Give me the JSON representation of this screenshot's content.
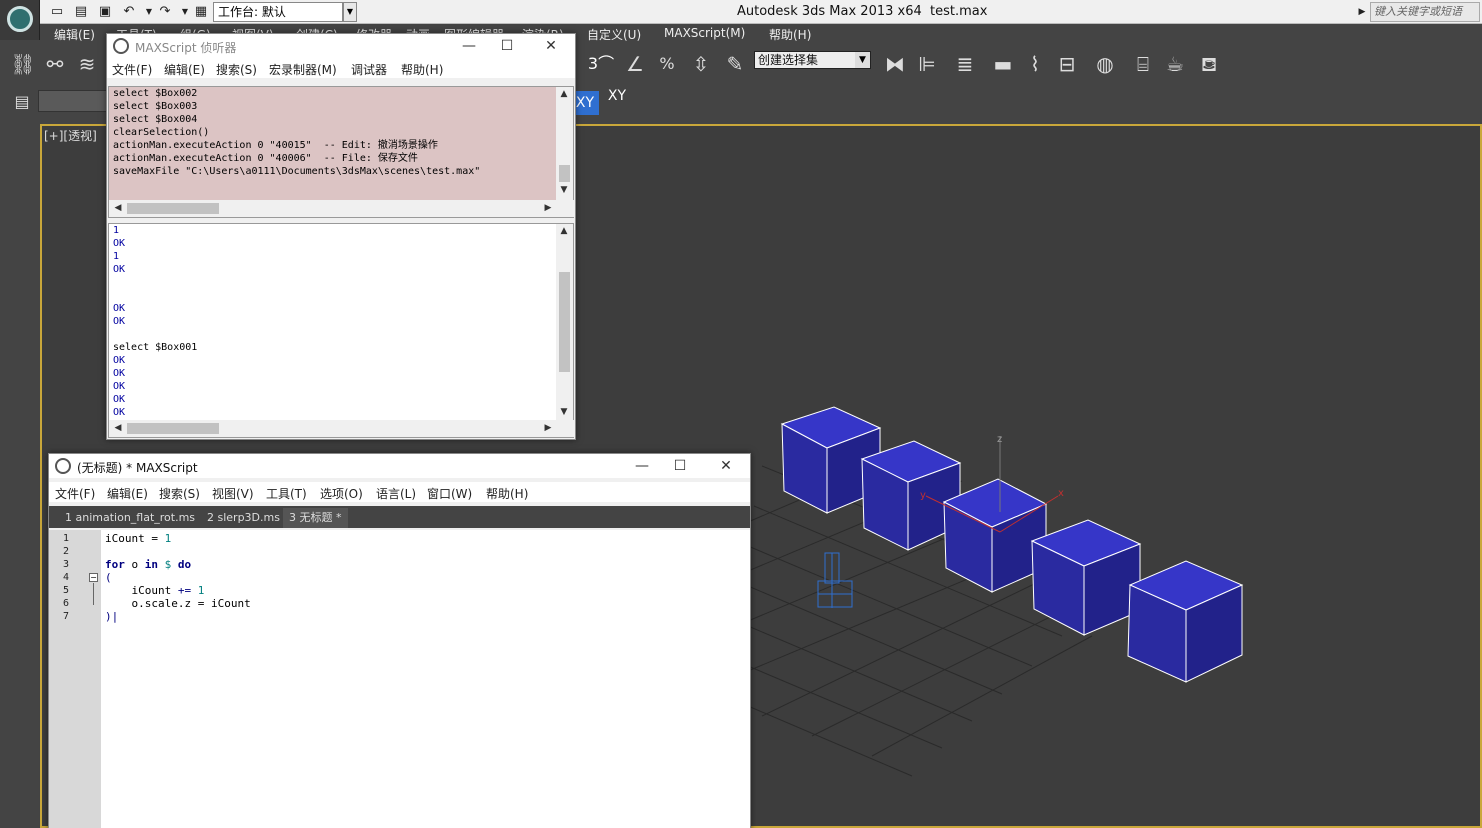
{
  "app": {
    "title": "Autodesk 3ds Max  2013 x64",
    "file": "test.max",
    "workspace_label": "工作台: 默认",
    "help_search_placeholder": "键入关键字或短语"
  },
  "menubar": {
    "items": [
      "编辑(E)",
      "工具(T)",
      "组(G)",
      "视图(V)",
      "创建(C)",
      "修改器",
      "动画",
      "图形编辑器",
      "渲染(R)",
      "自定义(U)",
      "MAXScript(M)",
      "帮助(H)"
    ]
  },
  "toolbar": {
    "selection_set_placeholder": "创建选择集",
    "axis_constraint": "XY",
    "axis_constraint_snap": "XY"
  },
  "viewport": {
    "label": "[+][透视]",
    "box_color": "#2b2ba8",
    "grid_color": "#2a2a2a",
    "axis_labels": {
      "z": "z",
      "x": "x",
      "y": "y"
    }
  },
  "listener": {
    "title": "MAXScript 侦听器",
    "menu": [
      "文件(F)",
      "编辑(E)",
      "搜索(S)",
      "宏录制器(M)",
      "调试器",
      "帮助(H)"
    ],
    "macro_pane_bg": "#dcc4c4",
    "macro_lines": [
      "select $Box002",
      "select $Box003",
      "select $Box004",
      "clearSelection()",
      "actionMan.executeAction 0 \"40015\"  -- Edit: 撤消场景操作",
      "actionMan.executeAction 0 \"40006\"  -- File: 保存文件",
      "saveMaxFile \"C:\\Users\\a0111\\Documents\\3dsMax\\scenes\\test.max\""
    ],
    "output_lines": [
      {
        "text": "1",
        "color": "#0000a0"
      },
      {
        "text": "OK",
        "color": "#0000a0"
      },
      {
        "text": "1",
        "color": "#0000a0"
      },
      {
        "text": "OK",
        "color": "#0000a0"
      },
      {
        "text": "",
        "color": "#0000a0"
      },
      {
        "text": "",
        "color": "#0000a0"
      },
      {
        "text": "OK",
        "color": "#0000a0"
      },
      {
        "text": "OK",
        "color": "#0000a0"
      },
      {
        "text": "",
        "color": "#0000a0"
      },
      {
        "text": "select $Box001",
        "color": "#000000"
      },
      {
        "text": "OK",
        "color": "#0000a0"
      },
      {
        "text": "OK",
        "color": "#0000a0"
      },
      {
        "text": "OK",
        "color": "#0000a0"
      },
      {
        "text": "OK",
        "color": "#0000a0"
      },
      {
        "text": "OK",
        "color": "#0000a0"
      }
    ]
  },
  "editor": {
    "title": "(无标题) * MAXScript",
    "menu": [
      "文件(F)",
      "编辑(E)",
      "搜索(S)",
      "视图(V)",
      "工具(T)",
      "选项(O)",
      "语言(L)",
      "窗口(W)",
      "帮助(H)"
    ],
    "tabs": [
      {
        "label": "1 animation_flat_rot.ms",
        "active": false
      },
      {
        "label": "2 slerp3D.ms",
        "active": false
      },
      {
        "label": "3 无标题 *",
        "active": true
      }
    ],
    "line_numbers": [
      "1",
      "2",
      "3",
      "4",
      "5",
      "6",
      "7"
    ],
    "code": {
      "l1_var": "iCount",
      "l1_eq": " = ",
      "l1_num": "1",
      "l3_for": "for",
      "l3_o": " o ",
      "l3_in": "in",
      "l3_dollar": " $ ",
      "l3_do": "do",
      "l4": "(",
      "l5_var": "    iCount ",
      "l5_op": "+=",
      "l5_num": " 1",
      "l6": "    o.scale.z = iCount",
      "l7": ")|"
    }
  }
}
